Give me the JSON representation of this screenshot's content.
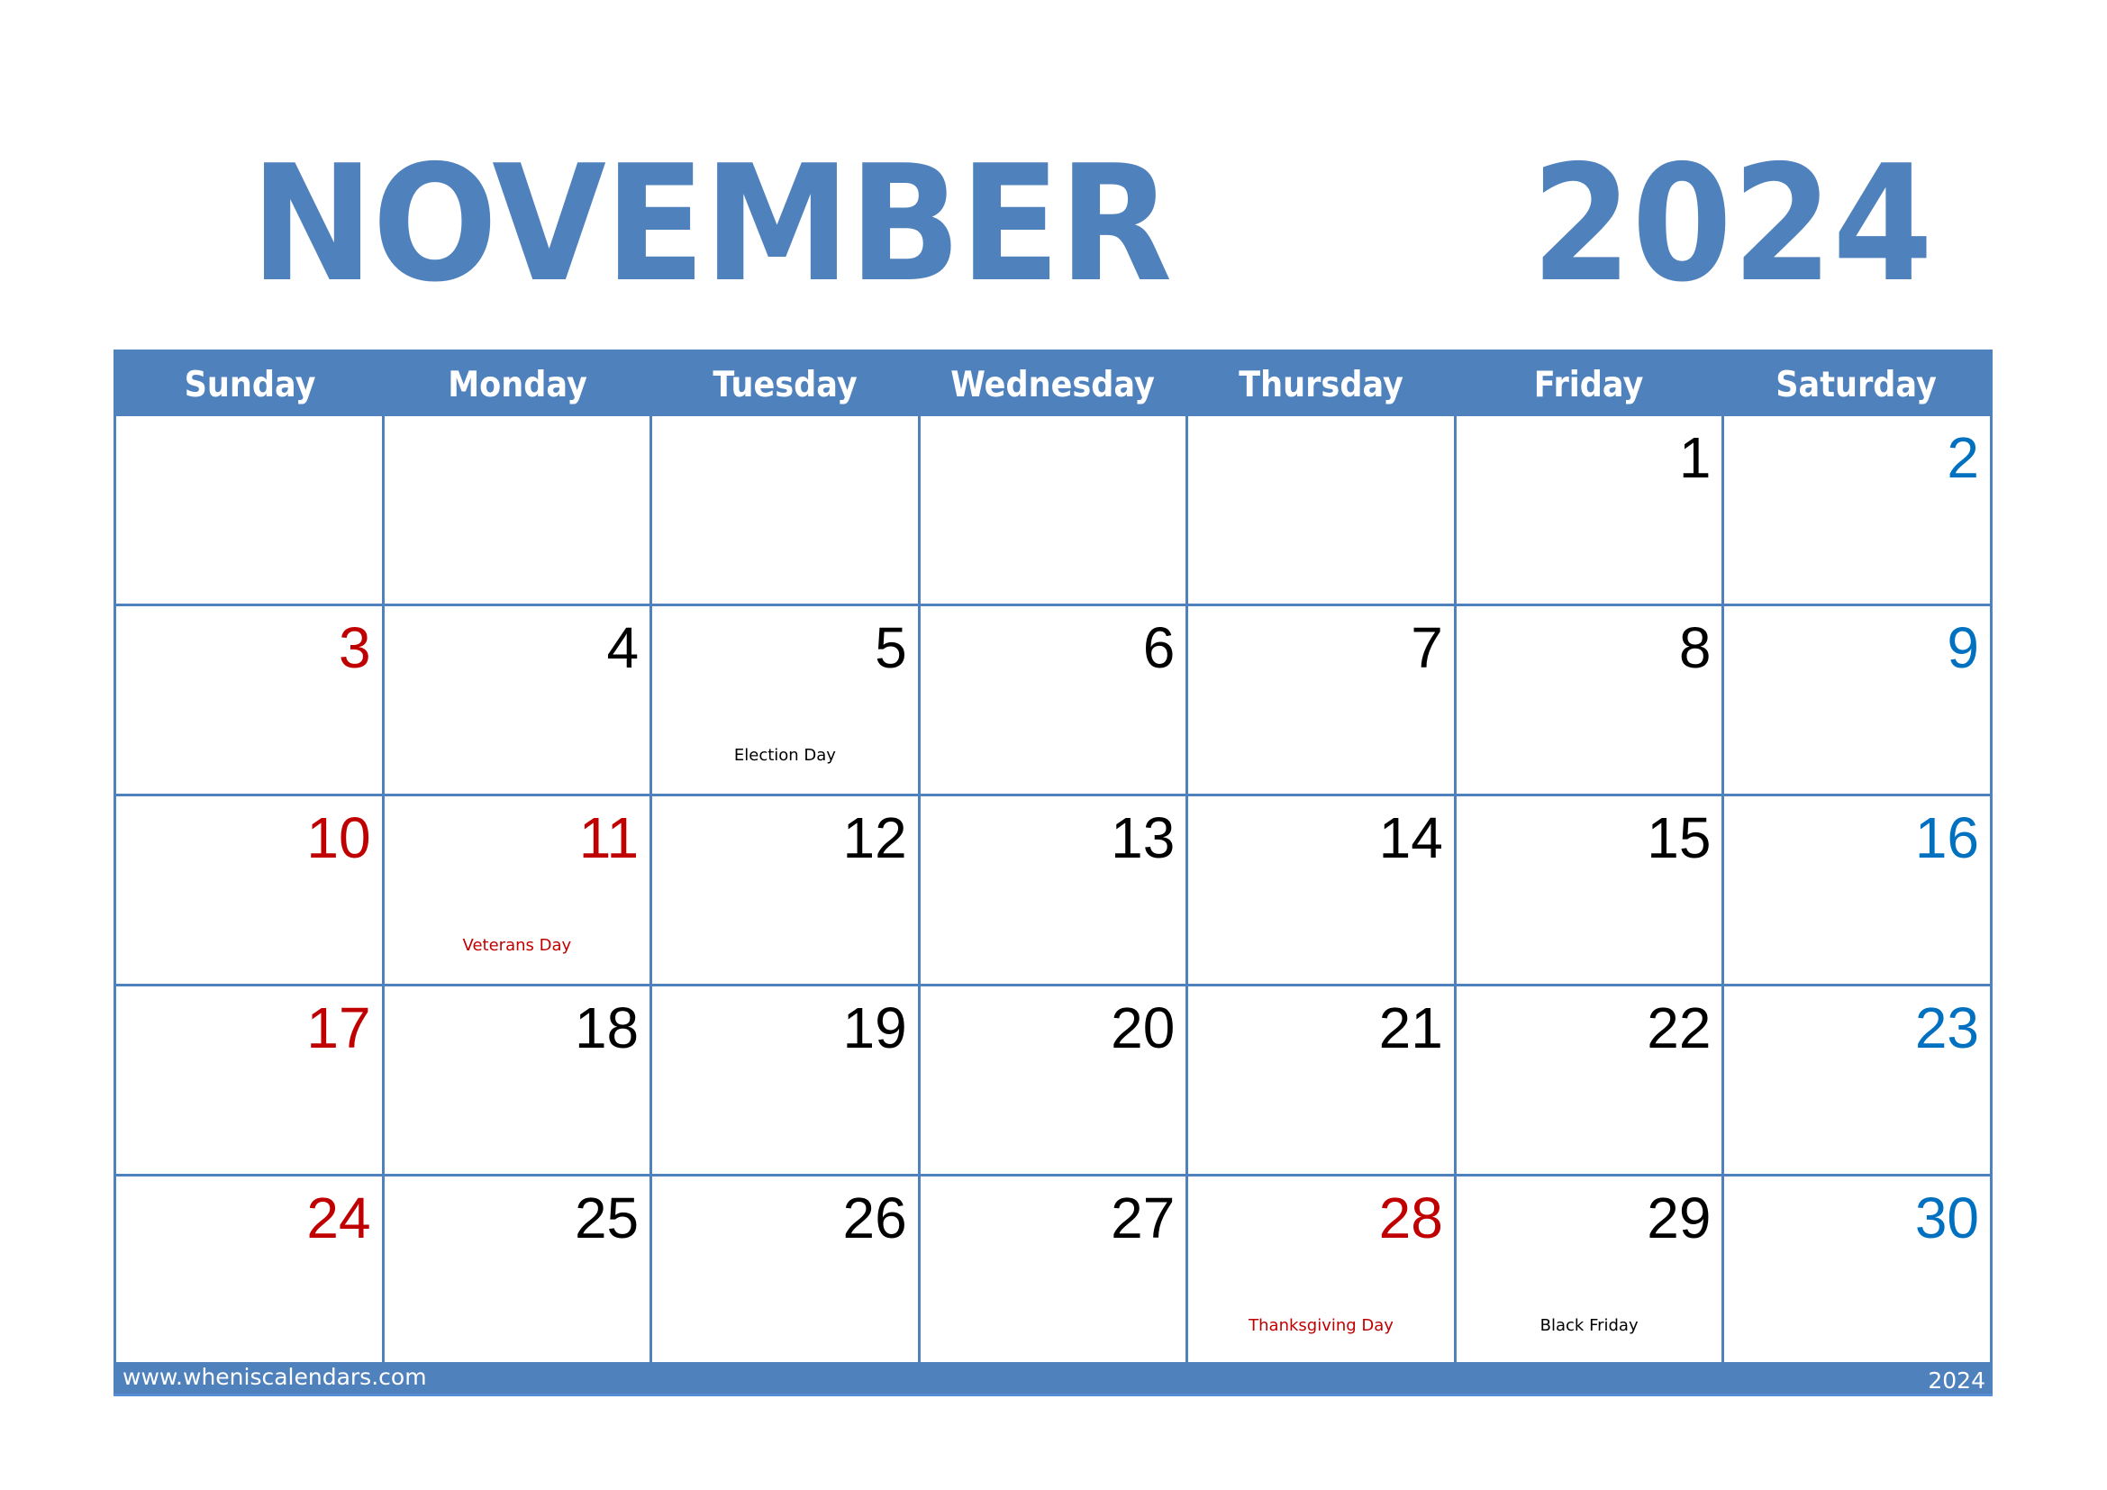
{
  "title": {
    "month": "NOVEMBER",
    "year": "2024"
  },
  "weekdays": [
    "Sunday",
    "Monday",
    "Tuesday",
    "Wednesday",
    "Thursday",
    "Friday",
    "Saturday"
  ],
  "colors": {
    "accent": "#4f81bd",
    "sunday_holiday": "#c00000",
    "saturday": "#0070c0",
    "weekday": "#000000"
  },
  "weeks": [
    [
      {
        "day": ""
      },
      {
        "day": ""
      },
      {
        "day": ""
      },
      {
        "day": ""
      },
      {
        "day": ""
      },
      {
        "day": "1",
        "color": "black"
      },
      {
        "day": "2",
        "color": "blue"
      }
    ],
    [
      {
        "day": "3",
        "color": "red"
      },
      {
        "day": "4",
        "color": "black"
      },
      {
        "day": "5",
        "color": "black",
        "holiday": "Election Day",
        "holiday_color": "black"
      },
      {
        "day": "6",
        "color": "black"
      },
      {
        "day": "7",
        "color": "black"
      },
      {
        "day": "8",
        "color": "black"
      },
      {
        "day": "9",
        "color": "blue"
      }
    ],
    [
      {
        "day": "10",
        "color": "red"
      },
      {
        "day": "11",
        "color": "red",
        "holiday": "Veterans Day",
        "holiday_color": "red"
      },
      {
        "day": "12",
        "color": "black"
      },
      {
        "day": "13",
        "color": "black"
      },
      {
        "day": "14",
        "color": "black"
      },
      {
        "day": "15",
        "color": "black"
      },
      {
        "day": "16",
        "color": "blue"
      }
    ],
    [
      {
        "day": "17",
        "color": "red"
      },
      {
        "day": "18",
        "color": "black"
      },
      {
        "day": "19",
        "color": "black"
      },
      {
        "day": "20",
        "color": "black"
      },
      {
        "day": "21",
        "color": "black"
      },
      {
        "day": "22",
        "color": "black"
      },
      {
        "day": "23",
        "color": "blue"
      }
    ],
    [
      {
        "day": "24",
        "color": "red"
      },
      {
        "day": "25",
        "color": "black"
      },
      {
        "day": "26",
        "color": "black"
      },
      {
        "day": "27",
        "color": "black"
      },
      {
        "day": "28",
        "color": "red",
        "holiday": "Thanksgiving Day",
        "holiday_color": "red"
      },
      {
        "day": "29",
        "color": "black",
        "holiday": "Black Friday",
        "holiday_color": "black"
      },
      {
        "day": "30",
        "color": "blue"
      }
    ]
  ],
  "footer": {
    "website": "www.wheniscalendars.com",
    "year": "2024"
  }
}
